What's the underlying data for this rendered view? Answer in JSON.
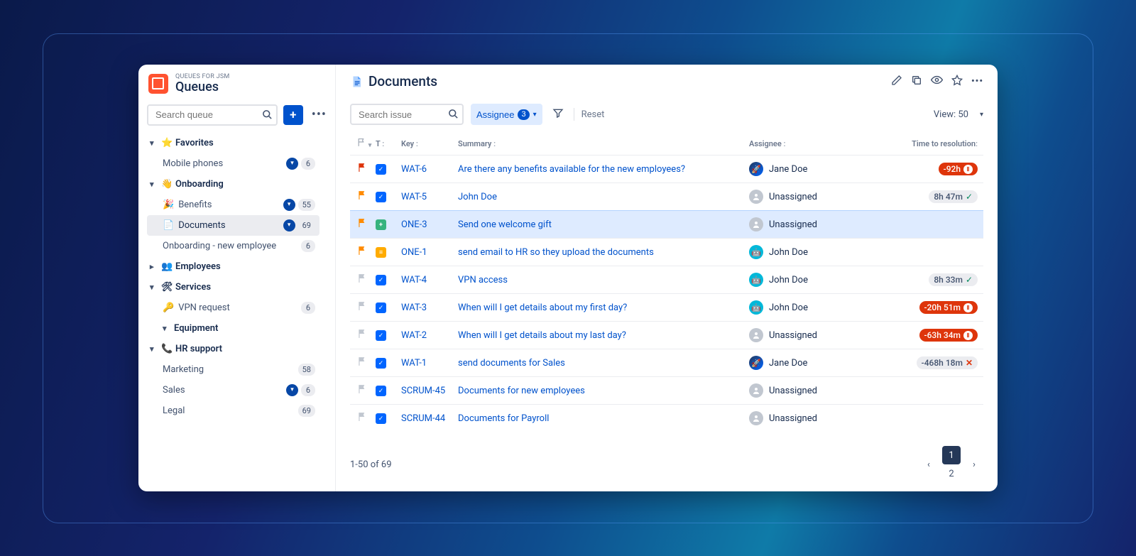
{
  "app": {
    "suptitle": "QUEUES FOR JSM",
    "title": "Queues"
  },
  "sidebar": {
    "search_placeholder": "Search queue",
    "groups": {
      "favorites": {
        "label": "Favorites",
        "icon": "⭐"
      },
      "onboarding": {
        "label": "Onboarding",
        "icon": "👋"
      },
      "employees": {
        "label": "Employees",
        "icon": "👥"
      },
      "services": {
        "label": "Services",
        "icon": "🛠"
      },
      "equipment": {
        "label": "Equipment"
      },
      "hr": {
        "label": "HR support",
        "icon": "📞"
      }
    },
    "items": {
      "mobile": {
        "label": "Mobile phones",
        "count": "6",
        "filtered": true
      },
      "benefits": {
        "label": "Benefits",
        "icon": "🎉",
        "count": "55",
        "filtered": true
      },
      "documents": {
        "label": "Documents",
        "icon": "📄",
        "count": "69",
        "filtered": true,
        "active": true
      },
      "onb_new": {
        "label": "Onboarding - new employee",
        "count": "6"
      },
      "vpn": {
        "label": "VPN request",
        "icon": "🔑",
        "count": "6"
      },
      "marketing": {
        "label": "Marketing",
        "count": "58"
      },
      "sales": {
        "label": "Sales",
        "count": "6",
        "filtered": true
      },
      "legal": {
        "label": "Legal",
        "count": "69"
      }
    }
  },
  "page": {
    "title": "Documents",
    "search_issue_placeholder": "Search issue",
    "assignee_label": "Assignee",
    "assignee_count": "3",
    "reset": "Reset",
    "view_label": "View: 50"
  },
  "columns": {
    "t": "T",
    "key": "Key",
    "summary": "Summary",
    "assignee": "Assignee",
    "resolution": "Time to resolution"
  },
  "rows": [
    {
      "flag": "red",
      "type": "blue",
      "key": "WAT-6",
      "summary": "Are there any benefits available for the new employees?",
      "assignee": "Jane Doe",
      "avatar": "jd",
      "res": "-92h",
      "res_style": "red-pause"
    },
    {
      "flag": "orange",
      "type": "blue",
      "key": "WAT-5",
      "summary": "John Doe",
      "assignee": "Unassigned",
      "avatar": "un",
      "res": "8h 47m",
      "res_style": "gray-check"
    },
    {
      "flag": "orange",
      "type": "green",
      "key": "ONE-3",
      "summary": "Send one welcome gift",
      "assignee": "Unassigned",
      "avatar": "un",
      "res": "",
      "selected": true
    },
    {
      "flag": "orange",
      "type": "yellow",
      "key": "ONE-1",
      "summary": "send email to HR so they upload the documents",
      "assignee": "John Doe",
      "avatar": "jn",
      "res": ""
    },
    {
      "flag": "gray",
      "type": "blue",
      "key": "WAT-4",
      "summary": "VPN access",
      "assignee": "John Doe",
      "avatar": "jn",
      "res": "8h 33m",
      "res_style": "gray-check"
    },
    {
      "flag": "gray",
      "type": "blue",
      "key": "WAT-3",
      "summary": "When will I get details about my first day?",
      "assignee": "John Doe",
      "avatar": "jn",
      "res": "-20h 51m",
      "res_style": "red-pause"
    },
    {
      "flag": "gray",
      "type": "blue",
      "key": "WAT-2",
      "summary": "When will I get details about my last day?",
      "assignee": "Unassigned",
      "avatar": "un",
      "res": "-63h 34m",
      "res_style": "red-pause"
    },
    {
      "flag": "gray",
      "type": "blue",
      "key": "WAT-1",
      "summary": "send documents for Sales",
      "assignee": "Jane Doe",
      "avatar": "jd",
      "res": "-468h 18m",
      "res_style": "gray-x"
    },
    {
      "flag": "gray",
      "type": "blue",
      "key": "SCRUM-45",
      "summary": "Documents for new employees",
      "assignee": "Unassigned",
      "avatar": "un",
      "res": ""
    },
    {
      "flag": "gray",
      "type": "blue",
      "key": "SCRUM-44",
      "summary": "Documents for Payroll",
      "assignee": "Unassigned",
      "avatar": "un",
      "res": ""
    }
  ],
  "footer": {
    "range": "1-50 of 69",
    "pages": [
      "1",
      "2"
    ],
    "current": "1"
  }
}
